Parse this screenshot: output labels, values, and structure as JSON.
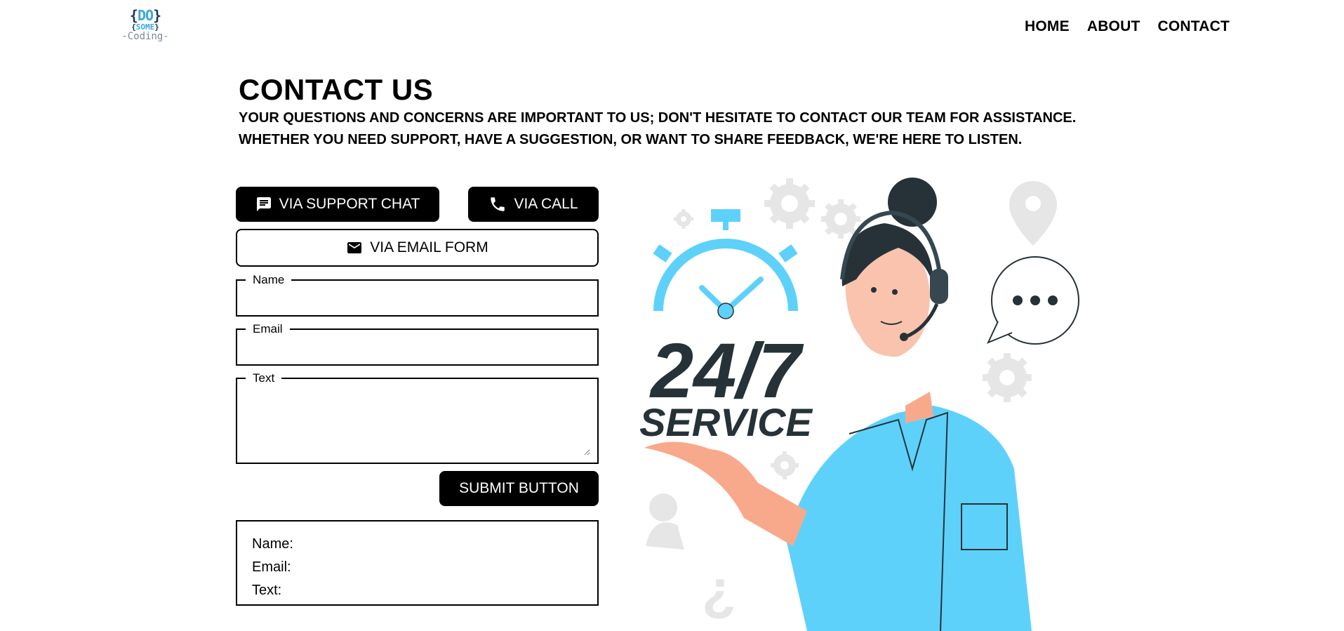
{
  "logo": {
    "line1": "DO",
    "line2": "SOME",
    "line3": "-Coding-"
  },
  "nav": {
    "home": "HOME",
    "about": "ABOUT",
    "contact": "CONTACT"
  },
  "page": {
    "title": "CONTACT US",
    "subtitle": "YOUR QUESTIONS AND CONCERNS ARE IMPORTANT TO US; DON'T HESITATE TO CONTACT OUR TEAM FOR ASSISTANCE. WHETHER YOU NEED SUPPORT, HAVE A SUGGESTION, OR WANT TO SHARE FEEDBACK, WE'RE HERE TO LISTEN."
  },
  "buttons": {
    "support_chat": "VIA SUPPORT CHAT",
    "call": "VIA CALL",
    "email_form": "VIA EMAIL FORM",
    "submit": "SUBMIT BUTTON"
  },
  "form": {
    "name_label": "Name",
    "name_value": "",
    "email_label": "Email",
    "email_value": "",
    "text_label": "Text",
    "text_value": ""
  },
  "output": {
    "name": "Name:",
    "email": "Email:",
    "text": "Text:"
  },
  "illustration": {
    "number": "24/7",
    "service": "SERVICE"
  },
  "colors": {
    "accent": "#5ed1fb",
    "dark": "#263238",
    "button": "#000000",
    "gear": "#e6e6e6"
  },
  "icons": [
    "chat-icon",
    "phone-icon",
    "mail-icon"
  ]
}
